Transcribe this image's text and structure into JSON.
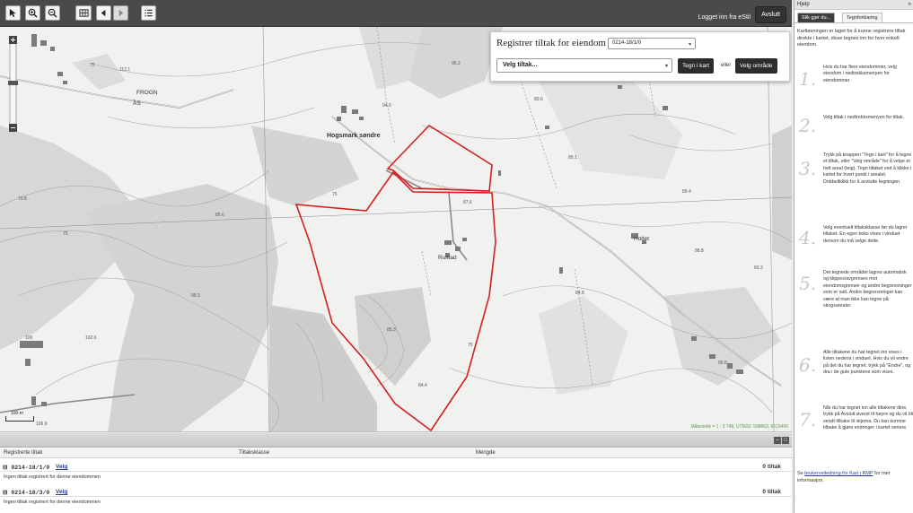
{
  "toolbar": {
    "login_text": "Logget inn fra eStil",
    "exit_label": "Avslutt"
  },
  "map": {
    "places": [
      "Hogsmark søndre",
      "Rustad",
      "Holtet",
      "ÅS",
      "FROGN"
    ],
    "elevations": [
      "112.1",
      "95.2",
      "94.6",
      "75",
      "85.6",
      "75",
      "75",
      "87.6",
      "89.1",
      "89.4",
      "89.6",
      "88.8",
      "84.8",
      "83.2",
      "85.3",
      "84.4",
      "75",
      "102.6",
      "99.3",
      "100",
      "106.9",
      "79.8",
      "90.8"
    ],
    "scalebar_label": "100 m",
    "attribution": "Målestokk = 1 : 3 748, UTM32: 598863, 6615490"
  },
  "register_panel": {
    "title": "Registrer tiltak for eiendom",
    "eiendom_value": "0214-18/1/0",
    "tiltak_placeholder": "Velg tiltak...",
    "draw_button": "Tegn i kart",
    "or_label": "eller",
    "select_area_button": "Velg område"
  },
  "table": {
    "columns": [
      "Registrerte tiltak",
      "Tiltaksklasse",
      "Mengde"
    ],
    "groups": [
      {
        "id": "0214-18/1/0",
        "link": "Velg",
        "count": "0 tiltak",
        "info": "Ingen tiltak registrert for denne eiendommen"
      },
      {
        "id": "0214-18/3/0",
        "link": "Velg",
        "count": "0 tiltak",
        "info": "Ingen tiltak registrert for denne eiendommen"
      }
    ]
  },
  "help": {
    "title": "Hjelp",
    "collapse": "»",
    "tabs": [
      "Slik gjør du...",
      "Tegnforklaring"
    ],
    "intro": "Kartløsningen er laget for å kunne registrere tiltak direkte i kartet, disse tegnes inn for hver enkelt eiendom.",
    "steps": [
      {
        "num": "1.",
        "text": "Hvis du har flere eiendommer, velg eiendom i nedtrekksmenyen for eiendommer."
      },
      {
        "num": "2.",
        "text": "Velg tiltak i nedtrekksmenyen for tiltak."
      },
      {
        "num": "3.",
        "text": "Trykk på knappen \"Tegn i kart\" for å tegne et tiltak, eller \"Velg område\" for å velge et helt areal (teig). Tegn tiltaket ved å klikke i kartet for hvert punkt i arealet. Dobbeltklikk for å avslutte tegningen."
      },
      {
        "num": "4.",
        "text": "Velg eventuelt tiltaksklasse før du lagrer tiltaket. En egen boks vises i vinduet dersom du må velge dette."
      },
      {
        "num": "5.",
        "text": "Det tegnede området lagres automatisk og klippes/avgrenses mot eiendomsgrenser og andre begrensninger som er satt. Andre begrensninger kan være at man ikke kan tegne på skogsarealer."
      },
      {
        "num": "6.",
        "text": "Alle tiltakene du har tegnet inn vises i listen nederst i vinduet. Hvis du vil endre på det du har tegnet, trykk på \"Endre\", og dra i de gule punktene som vises."
      },
      {
        "num": "7.",
        "text": "Når du har tegnet inn alle tiltakene dine, trykk på Avslutt øverst til høyre og du vil bli sendt tilbake til skjema. Du kan komme tilbake å gjøre endringer i kartet senere."
      }
    ],
    "footer_pre": "Se",
    "footer_link": "brukerveiledning for Kart i RMP",
    "footer_post": "for mer informasjon."
  }
}
